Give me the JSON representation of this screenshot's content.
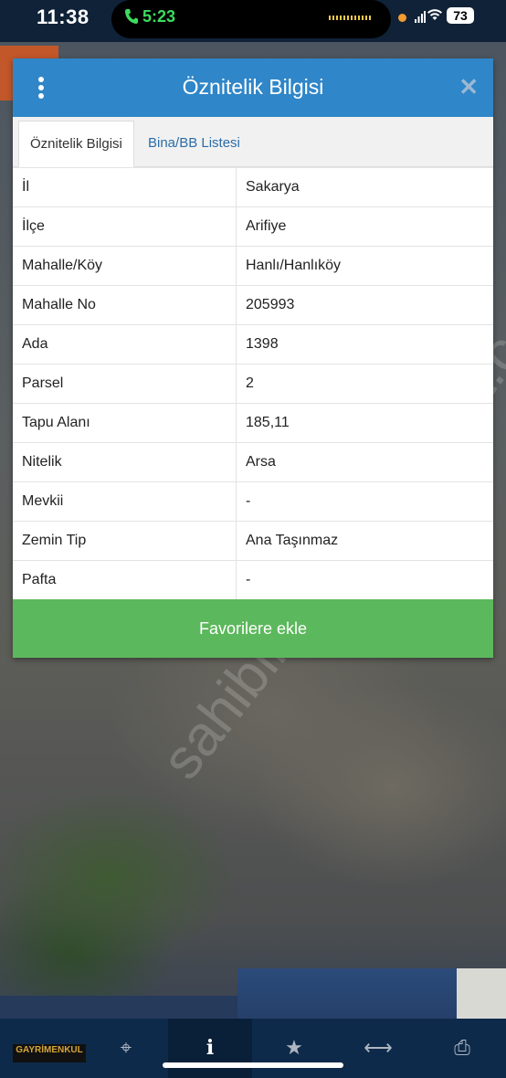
{
  "status_bar": {
    "time": "11:38",
    "call_time": "5:23",
    "battery": "73"
  },
  "dialog": {
    "title": "Öznitelik Bilgisi",
    "tabs": [
      {
        "label": "Öznitelik Bilgisi",
        "active": true
      },
      {
        "label": "Bina/BB Listesi",
        "active": false
      }
    ],
    "rows": [
      {
        "key": "İl",
        "value": "Sakarya"
      },
      {
        "key": "İlçe",
        "value": "Arifiye"
      },
      {
        "key": "Mahalle/Köy",
        "value": "Hanlı/Hanlıköy"
      },
      {
        "key": "Mahalle No",
        "value": "205993"
      },
      {
        "key": "Ada",
        "value": "1398"
      },
      {
        "key": "Parsel",
        "value": "2"
      },
      {
        "key": "Tapu Alanı",
        "value": "185,11"
      },
      {
        "key": "Nitelik",
        "value": "Arsa"
      },
      {
        "key": "Mevkii",
        "value": "-"
      },
      {
        "key": "Zemin Tip",
        "value": "Ana Taşınmaz"
      },
      {
        "key": "Pafta",
        "value": "-"
      }
    ],
    "favorite_button": "Favorilere ekle"
  },
  "watermark": "sahibinden emlakjet.com",
  "toolbar": {
    "logo_text": "GAYRİMENKUL",
    "items": [
      {
        "icon": "location-target-icon",
        "glyph": "⌖"
      },
      {
        "icon": "info-icon",
        "glyph": "i"
      },
      {
        "icon": "star-icon",
        "glyph": "★"
      },
      {
        "icon": "measure-arrows-icon",
        "glyph": "⟷"
      },
      {
        "icon": "print-icon",
        "glyph": "⎙"
      }
    ]
  }
}
